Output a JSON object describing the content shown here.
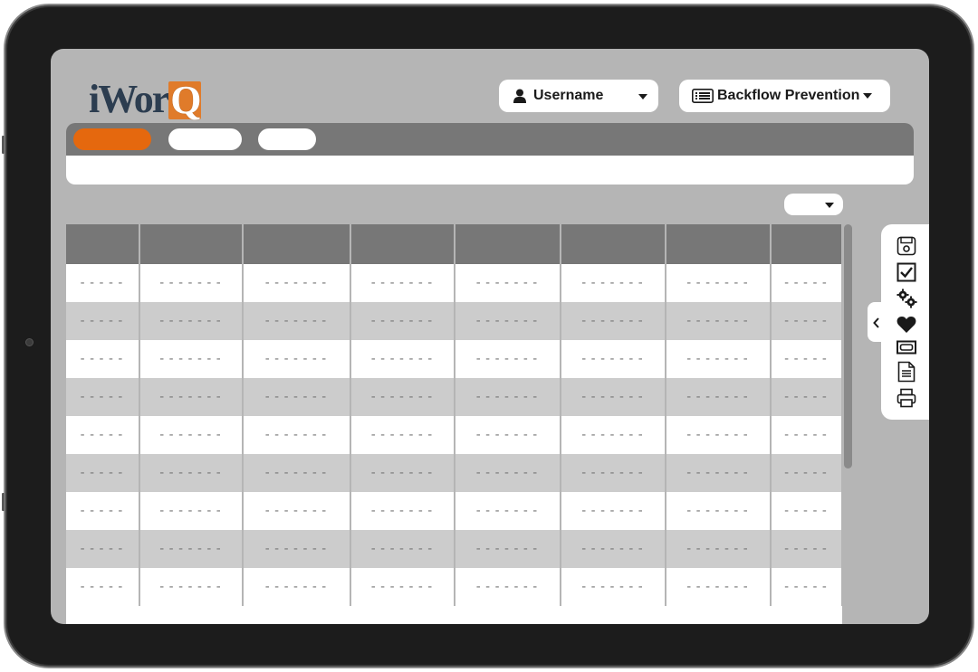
{
  "header": {
    "logo": {
      "text_i": "i",
      "text_wor": "Wor",
      "text_q": "Q"
    },
    "user_menu": {
      "label": "Username",
      "icon": "user-icon"
    },
    "module_menu": {
      "label": "Backflow Prevention",
      "icon": "list-icon"
    }
  },
  "nav": {
    "tabs": [
      {
        "state": "active"
      },
      {
        "state": "inactive"
      },
      {
        "state": "inactive"
      }
    ]
  },
  "table": {
    "header": [
      "",
      "",
      "",
      "",
      "",
      "",
      "",
      ""
    ],
    "rows": [
      [
        "-----",
        "-------",
        "-------",
        "-------",
        "-------",
        "-------",
        "-------",
        "-----"
      ],
      [
        "-----",
        "-------",
        "-------",
        "-------",
        "-------",
        "-------",
        "-------",
        "-----"
      ],
      [
        "-----",
        "-------",
        "-------",
        "-------",
        "-------",
        "-------",
        "-------",
        "-----"
      ],
      [
        "-----",
        "-------",
        "-------",
        "-------",
        "-------",
        "-------",
        "-------",
        "-----"
      ],
      [
        "-----",
        "-------",
        "-------",
        "-------",
        "-------",
        "-------",
        "-------",
        "-----"
      ],
      [
        "-----",
        "-------",
        "-------",
        "-------",
        "-------",
        "-------",
        "-------",
        "-----"
      ],
      [
        "-----",
        "-------",
        "-------",
        "-------",
        "-------",
        "-------",
        "-------",
        "-----"
      ],
      [
        "-----",
        "-------",
        "-------",
        "-------",
        "-------",
        "-------",
        "-------",
        "-----"
      ],
      [
        "-----",
        "-------",
        "-------",
        "-------",
        "-------",
        "-------",
        "-------",
        "-----"
      ]
    ]
  },
  "toolbar": {
    "icons": [
      "save-icon",
      "checkbox-icon",
      "gears-icon",
      "heart-icon",
      "ticket-icon",
      "document-icon",
      "printer-icon"
    ],
    "toggle_icon": "chevron-left-icon"
  },
  "colors": {
    "accent": "#e5680e",
    "logo_dark": "#2c3d50",
    "logo_orange": "#e07b2a",
    "nav_bg": "#777777",
    "screen_bg": "#b5b5b5"
  }
}
